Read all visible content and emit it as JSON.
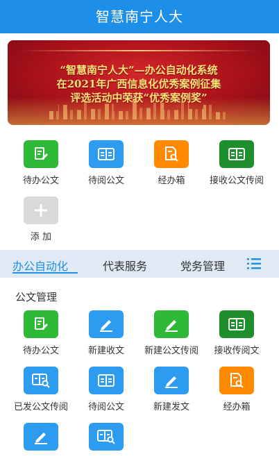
{
  "header": {
    "title": "智慧南宁人大"
  },
  "banner": {
    "line1": "“智慧南宁人大”—办公自动化系统",
    "line2": "在2021年广西信息化优秀案例征集",
    "line3": "评选活动中荣获“优秀案例奖”"
  },
  "quick": [
    {
      "label": "待办公文",
      "icon": "edit-doc-icon",
      "color": "#2fb938"
    },
    {
      "label": "待阅公文",
      "icon": "book-icon",
      "color": "#2d9bf0"
    },
    {
      "label": "经办箱",
      "icon": "doc-search-icon",
      "color": "#ff8a00"
    },
    {
      "label": "接收公文传阅",
      "icon": "book-icon",
      "color": "#1f8f2d"
    },
    {
      "label": "添 加",
      "icon": "plus-icon",
      "color": "#d9d9d9"
    }
  ],
  "tabs": [
    {
      "label": "办公自动化",
      "active": true
    },
    {
      "label": "代表服务",
      "active": false
    },
    {
      "label": "党务管理",
      "active": false
    }
  ],
  "section": {
    "title": "公文管理",
    "items": [
      {
        "label": "待办公文",
        "icon": "edit-doc-icon",
        "color": "#2fb938"
      },
      {
        "label": "新建收文",
        "icon": "pencil-icon",
        "color": "#2d9bf0"
      },
      {
        "label": "新建公文传阅",
        "icon": "pencil-icon",
        "color": "#2fb938"
      },
      {
        "label": "接收传阅文",
        "icon": "book-icon",
        "color": "#1f8f2d"
      },
      {
        "label": "已发公文传阅",
        "icon": "book-search-icon",
        "color": "#2d9bf0"
      },
      {
        "label": "待阅公文",
        "icon": "book-icon",
        "color": "#2d9bf0"
      },
      {
        "label": "新建发文",
        "icon": "pencil-icon",
        "color": "#2d9bf0"
      },
      {
        "label": "经办箱",
        "icon": "doc-search-icon",
        "color": "#ff8a00"
      },
      {
        "label": "",
        "icon": "pencil-icon",
        "color": "#2d9bf0"
      },
      {
        "label": "",
        "icon": "book-search-icon",
        "color": "#2d9bf0"
      }
    ]
  }
}
